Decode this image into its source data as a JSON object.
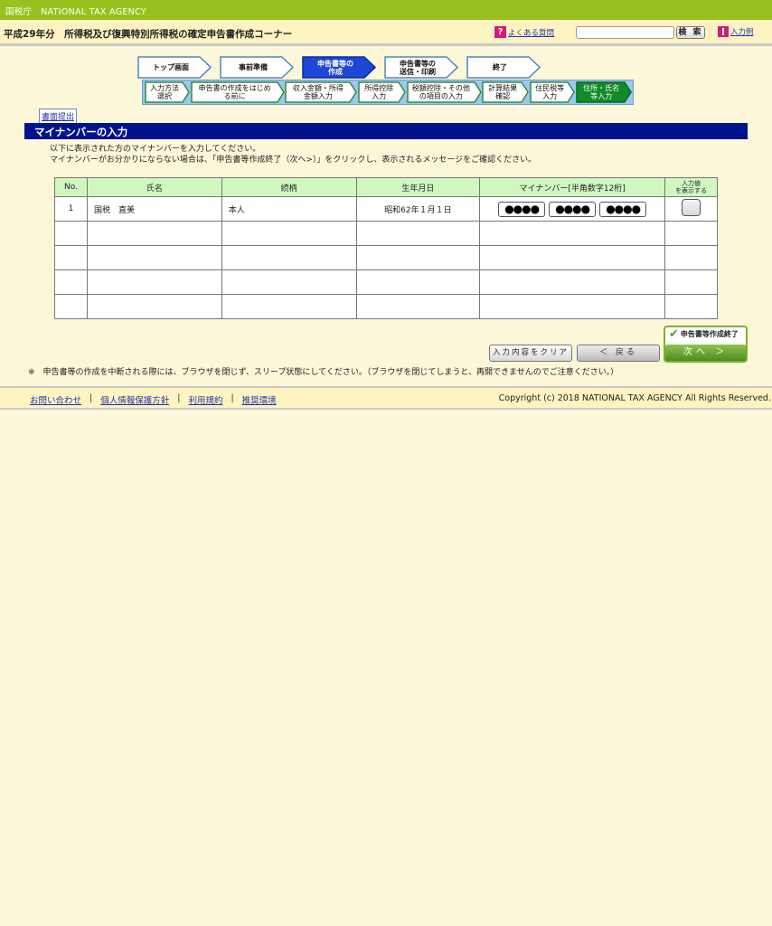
{
  "agency": {
    "name": "国税庁　NATIONAL TAX AGENCY"
  },
  "header": {
    "corner_title": "平成29年分　所得税及び復興特別所得税の確定申告書作成コーナー",
    "faq_label": "よくある質問",
    "search_placeholder": "",
    "search_button": "検 索",
    "example_label": "入力例"
  },
  "steps_main": [
    {
      "label": "トップ画面",
      "active": false
    },
    {
      "label": "事前準備",
      "active": false
    },
    {
      "label": "申告書等の\n作成",
      "active": true
    },
    {
      "label": "申告書等の\n送信・印刷",
      "active": false
    },
    {
      "label": "終了",
      "active": false
    }
  ],
  "steps_sub": [
    {
      "label": "入力方法\n選択",
      "active": false
    },
    {
      "label": "申告書の作成をはじめ\nる前に",
      "active": false
    },
    {
      "label": "収入金額・所得\n金額入力",
      "active": false
    },
    {
      "label": "所得控除\n入力",
      "active": false
    },
    {
      "label": "税額控除・その他\nの項目の入力",
      "active": false
    },
    {
      "label": "計算結果\n確認",
      "active": false
    },
    {
      "label": "住民税等\n入力",
      "active": false
    },
    {
      "label": "住所・氏名\n等入力",
      "active": true
    }
  ],
  "submit_link": "書面提出",
  "section_title": "マイナンバーの入力",
  "intro": {
    "line1": "以下に表示された方のマイナンバーを入力してください。",
    "line2": "マイナンバーがお分かりにならない場合は、「申告書等作成終了（次へ>）」をクリックし、表示されるメッセージをご確認ください。"
  },
  "table": {
    "headers": {
      "no": "No.",
      "name": "氏名",
      "relation": "続柄",
      "birth": "生年月日",
      "mynumber": "マイナンバー[半角数字12桁]",
      "show": "入力値\nを表示する"
    },
    "rows": [
      {
        "no": "1",
        "name": "国税　直美",
        "relation": "本人",
        "birth": "昭和62年１月１日",
        "mn1": "●●●●",
        "mn2": "●●●●",
        "mn3": "●●●●"
      }
    ],
    "empty_rows": 4
  },
  "buttons": {
    "clear": "入力内容をクリア",
    "back": "＜ 戻る",
    "finish": "申告書等作成終了",
    "next": "次へ ＞"
  },
  "note": "※　申告書等の作成を中断される際には、ブラウザを閉じず、スリープ状態にしてください。（ブラウザを閉じてしまうと、再開できませんのでご注意ください。）",
  "footer": {
    "links": [
      "お問い合わせ",
      "個人情報保護方針",
      "利用規約",
      "推奨環境"
    ],
    "separator": "|",
    "copyright": "Copyright (c) 2018 NATIONAL TAX AGENCY All Rights Reserved."
  },
  "colors": {
    "active_main": "#1d47d6",
    "active_sub": "#118a2a",
    "title_bar": "#00138c"
  }
}
